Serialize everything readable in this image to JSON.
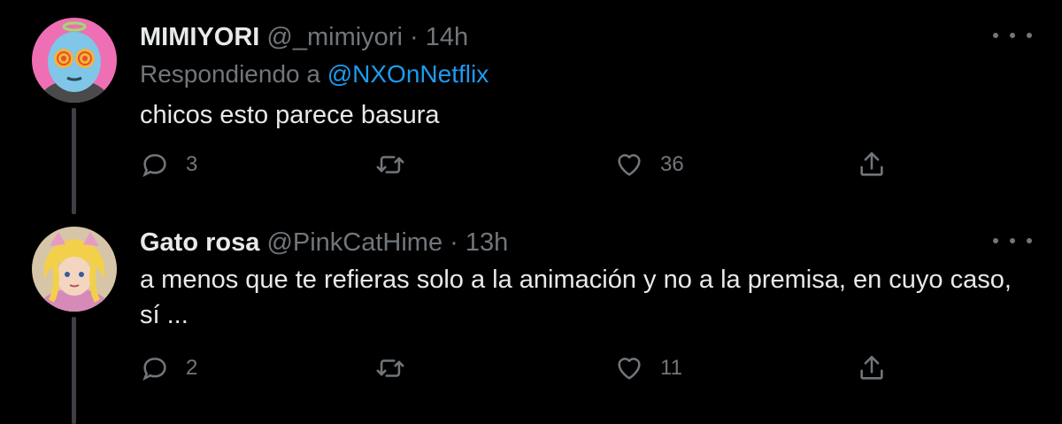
{
  "tweets": [
    {
      "name": "MIMIYORI",
      "handle": "@_mimiyori",
      "separator": "·",
      "time": "14h",
      "replying_prefix": "Respondiendo a",
      "replying_to": "@NXOnNetflix",
      "text": "chicos esto parece basura",
      "replies": "3",
      "retweets": "",
      "likes": "36"
    },
    {
      "name": "Gato rosa",
      "handle": "@PinkCatHime",
      "separator": "·",
      "time": "13h",
      "text": "a menos que te refieras solo a la animación y no a la premisa, en cuyo caso, sí ...",
      "replies": "2",
      "retweets": "",
      "likes": "11"
    }
  ],
  "colors": {
    "background": "#000000",
    "primary_text": "#e7e9ea",
    "secondary_text": "#71767b",
    "link": "#1d9bf0",
    "thread_line": "#3d4044"
  },
  "icons": [
    "reply-icon",
    "retweet-icon",
    "like-icon",
    "share-icon",
    "more-icon"
  ]
}
